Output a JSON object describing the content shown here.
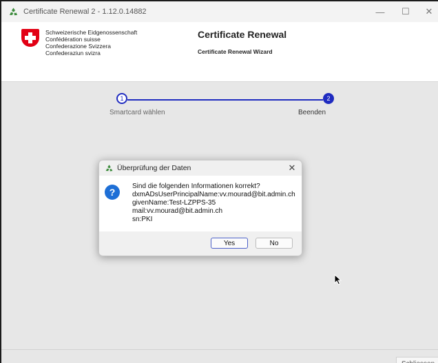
{
  "window": {
    "title": "Certificate Renewal 2 - 1.12.0.14882",
    "minimize_glyph": "—",
    "maximize_glyph": "☐",
    "close_glyph": "✕",
    "icon": "recycle-icon"
  },
  "header": {
    "agency_lines": [
      "Schweizerische Eidgenossenschaft",
      "Confédération suisse",
      "Confederazione Svizzera",
      "Confederaziun svizra"
    ],
    "title": "Certificate Renewal",
    "subtitle": "Certificate Renewal Wizard",
    "logo": "swiss-flag-icon"
  },
  "wizard": {
    "steps": [
      {
        "number": "1",
        "label": "Smartcard wählen",
        "state": "done"
      },
      {
        "number": "2",
        "label": "Beenden",
        "state": "current"
      }
    ],
    "accent_color": "#1f2bc0"
  },
  "dialog": {
    "title": "Überprüfung der Daten",
    "icon": "question-icon",
    "question_glyph": "?",
    "close_glyph": "✕",
    "message_lines": [
      "Sind die folgenden Informationen korrekt?",
      "dxmADsUserPrincipalName:vv.mourad@bit.admin.ch",
      "givenName:Test-LZPPS-35",
      "mail:vv.mourad@bit.admin.ch",
      "sn:PKI"
    ],
    "yes_label": "Yes",
    "no_label": "No"
  },
  "footer": {
    "close_label": "Schliessen"
  }
}
